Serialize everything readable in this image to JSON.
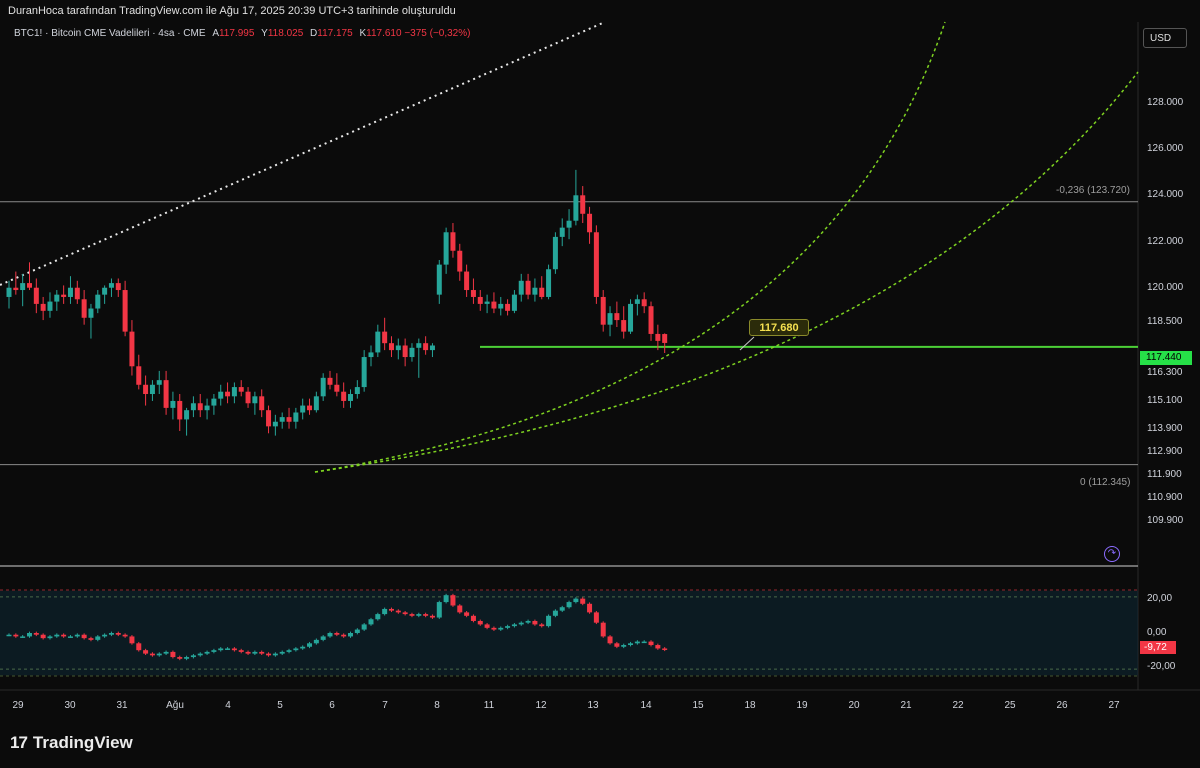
{
  "header": {
    "caption": "DuranHoca tarafından TradingView.com ile Ağu 17, 2025 20:39 UTC+3 tarihinde oluşturuldu"
  },
  "symbol": {
    "title": "BTC1! · Bitcoin CME Vadelileri · 4sa · CME",
    "open_label": "A",
    "open_value": "117.995",
    "high_label": "Y",
    "high_value": "118.025",
    "low_label": "D",
    "low_value": "117.175",
    "close_label": "K",
    "close_value": "117.610",
    "change": "−375 (−0,32%)"
  },
  "currency_button": "USD",
  "price_axis": [
    "128.000",
    "126.000",
    "124.000",
    "122.000",
    "120.000",
    "118.500",
    "116.300",
    "115.100",
    "113.900",
    "112.900",
    "111.900",
    "110.900",
    "109.900"
  ],
  "price_axis_values": [
    128000,
    126000,
    124000,
    122000,
    120000,
    118500,
    116300,
    115100,
    113900,
    112900,
    111900,
    110900,
    109900
  ],
  "current_price": "117.440",
  "callout_price": "117.680",
  "fib_labels": {
    "upper": "-0,236 (123.720)",
    "lower": "0 (112.345)"
  },
  "oscillator": {
    "axis": [
      "20,00",
      "0,00",
      "-20,00"
    ],
    "axis_values": [
      20,
      0,
      -20
    ],
    "current": "-9,72"
  },
  "time_axis": [
    "29",
    "30",
    "31",
    "Ağu",
    "4",
    "5",
    "6",
    "7",
    "8",
    "11",
    "12",
    "13",
    "14",
    "15",
    "18",
    "19",
    "20",
    "21",
    "22",
    "25",
    "26",
    "27"
  ],
  "brand": {
    "mark": "17",
    "name": "TradingView"
  },
  "colors": {
    "up": "#26a69a",
    "down": "#f23645",
    "price_line": "#4cd137",
    "curve": "#7ed321",
    "background": "#0b0b0b"
  },
  "chart_data": {
    "type": "candlestick",
    "interval": "4h",
    "candles": [
      {
        "o": 119600,
        "h": 120300,
        "l": 119100,
        "c": 120000
      },
      {
        "o": 120000,
        "h": 120700,
        "l": 119700,
        "c": 119900
      },
      {
        "o": 119900,
        "h": 120600,
        "l": 119200,
        "c": 120200
      },
      {
        "o": 120200,
        "h": 121100,
        "l": 119900,
        "c": 120000
      },
      {
        "o": 120000,
        "h": 120400,
        "l": 118900,
        "c": 119300
      },
      {
        "o": 119300,
        "h": 119600,
        "l": 118600,
        "c": 119000
      },
      {
        "o": 119000,
        "h": 119800,
        "l": 118700,
        "c": 119400
      },
      {
        "o": 119400,
        "h": 119900,
        "l": 119000,
        "c": 119700
      },
      {
        "o": 119700,
        "h": 120100,
        "l": 119300,
        "c": 119600
      },
      {
        "o": 119600,
        "h": 120500,
        "l": 119300,
        "c": 120000
      },
      {
        "o": 120000,
        "h": 120300,
        "l": 119300,
        "c": 119500
      },
      {
        "o": 119500,
        "h": 119900,
        "l": 118400,
        "c": 118700
      },
      {
        "o": 118700,
        "h": 119300,
        "l": 117800,
        "c": 119100
      },
      {
        "o": 119100,
        "h": 119900,
        "l": 118900,
        "c": 119700
      },
      {
        "o": 119700,
        "h": 120100,
        "l": 119300,
        "c": 120000
      },
      {
        "o": 120000,
        "h": 120400,
        "l": 119600,
        "c": 120200
      },
      {
        "o": 120200,
        "h": 120400,
        "l": 119600,
        "c": 119900
      },
      {
        "o": 119900,
        "h": 120300,
        "l": 117900,
        "c": 118100
      },
      {
        "o": 118100,
        "h": 118600,
        "l": 116200,
        "c": 116600
      },
      {
        "o": 116600,
        "h": 117100,
        "l": 115600,
        "c": 115800
      },
      {
        "o": 115800,
        "h": 116200,
        "l": 114900,
        "c": 115400
      },
      {
        "o": 115400,
        "h": 116000,
        "l": 115100,
        "c": 115800
      },
      {
        "o": 115800,
        "h": 116400,
        "l": 115400,
        "c": 116000
      },
      {
        "o": 116000,
        "h": 116400,
        "l": 114500,
        "c": 114800
      },
      {
        "o": 114800,
        "h": 115500,
        "l": 114300,
        "c": 115100
      },
      {
        "o": 115100,
        "h": 115400,
        "l": 113800,
        "c": 114300
      },
      {
        "o": 114300,
        "h": 114800,
        "l": 113600,
        "c": 114700
      },
      {
        "o": 114700,
        "h": 115300,
        "l": 114400,
        "c": 115000
      },
      {
        "o": 115000,
        "h": 115400,
        "l": 114400,
        "c": 114700
      },
      {
        "o": 114700,
        "h": 115200,
        "l": 114300,
        "c": 114900
      },
      {
        "o": 114900,
        "h": 115400,
        "l": 114500,
        "c": 115200
      },
      {
        "o": 115200,
        "h": 115800,
        "l": 114900,
        "c": 115500
      },
      {
        "o": 115500,
        "h": 115900,
        "l": 115000,
        "c": 115300
      },
      {
        "o": 115300,
        "h": 115900,
        "l": 115000,
        "c": 115700
      },
      {
        "o": 115700,
        "h": 116000,
        "l": 115300,
        "c": 115500
      },
      {
        "o": 115500,
        "h": 115700,
        "l": 114800,
        "c": 115000
      },
      {
        "o": 115000,
        "h": 115500,
        "l": 114500,
        "c": 115300
      },
      {
        "o": 115300,
        "h": 115600,
        "l": 114400,
        "c": 114700
      },
      {
        "o": 114700,
        "h": 114900,
        "l": 113700,
        "c": 114000
      },
      {
        "o": 114000,
        "h": 114500,
        "l": 113600,
        "c": 114200
      },
      {
        "o": 114200,
        "h": 114600,
        "l": 113900,
        "c": 114400
      },
      {
        "o": 114400,
        "h": 114800,
        "l": 113900,
        "c": 114200
      },
      {
        "o": 114200,
        "h": 114800,
        "l": 113900,
        "c": 114600
      },
      {
        "o": 114600,
        "h": 115200,
        "l": 114300,
        "c": 114900
      },
      {
        "o": 114900,
        "h": 115200,
        "l": 114500,
        "c": 114700
      },
      {
        "o": 114700,
        "h": 115500,
        "l": 114600,
        "c": 115300
      },
      {
        "o": 115300,
        "h": 116300,
        "l": 115100,
        "c": 116100
      },
      {
        "o": 116100,
        "h": 116400,
        "l": 115600,
        "c": 115800
      },
      {
        "o": 115800,
        "h": 116300,
        "l": 115300,
        "c": 115500
      },
      {
        "o": 115500,
        "h": 115900,
        "l": 114800,
        "c": 115100
      },
      {
        "o": 115100,
        "h": 115600,
        "l": 114800,
        "c": 115400
      },
      {
        "o": 115400,
        "h": 116000,
        "l": 115200,
        "c": 115700
      },
      {
        "o": 115700,
        "h": 117300,
        "l": 115500,
        "c": 117000
      },
      {
        "o": 117000,
        "h": 117500,
        "l": 116600,
        "c": 117200
      },
      {
        "o": 117200,
        "h": 118400,
        "l": 117000,
        "c": 118100
      },
      {
        "o": 118100,
        "h": 118700,
        "l": 117300,
        "c": 117600
      },
      {
        "o": 117600,
        "h": 117900,
        "l": 117000,
        "c": 117300
      },
      {
        "o": 117300,
        "h": 117800,
        "l": 116900,
        "c": 117500
      },
      {
        "o": 117500,
        "h": 117800,
        "l": 116600,
        "c": 117000
      },
      {
        "o": 117000,
        "h": 117600,
        "l": 116800,
        "c": 117400
      },
      {
        "o": 117400,
        "h": 117800,
        "l": 116100,
        "c": 117600
      },
      {
        "o": 117600,
        "h": 117900,
        "l": 117100,
        "c": 117300
      },
      {
        "o": 117300,
        "h": 117600,
        "l": 117000,
        "c": 117500
      },
      {
        "o": 119700,
        "h": 121200,
        "l": 119300,
        "c": 121000
      },
      {
        "o": 121000,
        "h": 122600,
        "l": 120600,
        "c": 122400
      },
      {
        "o": 122400,
        "h": 122800,
        "l": 121300,
        "c": 121600
      },
      {
        "o": 121600,
        "h": 121900,
        "l": 120300,
        "c": 120700
      },
      {
        "o": 120700,
        "h": 121000,
        "l": 119600,
        "c": 119900
      },
      {
        "o": 119900,
        "h": 120400,
        "l": 119300,
        "c": 119600
      },
      {
        "o": 119600,
        "h": 119900,
        "l": 119000,
        "c": 119300
      },
      {
        "o": 119300,
        "h": 119700,
        "l": 118900,
        "c": 119400
      },
      {
        "o": 119400,
        "h": 119800,
        "l": 118900,
        "c": 119100
      },
      {
        "o": 119100,
        "h": 119600,
        "l": 118800,
        "c": 119300
      },
      {
        "o": 119300,
        "h": 119500,
        "l": 118800,
        "c": 119000
      },
      {
        "o": 119000,
        "h": 119900,
        "l": 118900,
        "c": 119700
      },
      {
        "o": 119700,
        "h": 120600,
        "l": 119400,
        "c": 120300
      },
      {
        "o": 120300,
        "h": 120600,
        "l": 119500,
        "c": 119700
      },
      {
        "o": 119700,
        "h": 120400,
        "l": 119400,
        "c": 120000
      },
      {
        "o": 120000,
        "h": 120500,
        "l": 119500,
        "c": 119600
      },
      {
        "o": 119600,
        "h": 121000,
        "l": 119500,
        "c": 120800
      },
      {
        "o": 120800,
        "h": 122400,
        "l": 120600,
        "c": 122200
      },
      {
        "o": 122200,
        "h": 123000,
        "l": 121800,
        "c": 122600
      },
      {
        "o": 122600,
        "h": 123400,
        "l": 122100,
        "c": 122900
      },
      {
        "o": 122900,
        "h": 125100,
        "l": 122700,
        "c": 124000
      },
      {
        "o": 124000,
        "h": 124400,
        "l": 122800,
        "c": 123200
      },
      {
        "o": 123200,
        "h": 123500,
        "l": 121900,
        "c": 122400
      },
      {
        "o": 122400,
        "h": 122700,
        "l": 119300,
        "c": 119600
      },
      {
        "o": 119600,
        "h": 119900,
        "l": 118100,
        "c": 118400
      },
      {
        "o": 118400,
        "h": 119200,
        "l": 117900,
        "c": 118900
      },
      {
        "o": 118900,
        "h": 119400,
        "l": 118300,
        "c": 118600
      },
      {
        "o": 118600,
        "h": 119200,
        "l": 117800,
        "c": 118100
      },
      {
        "o": 118100,
        "h": 119500,
        "l": 118000,
        "c": 119300
      },
      {
        "o": 119300,
        "h": 119700,
        "l": 118800,
        "c": 119500
      },
      {
        "o": 119500,
        "h": 119800,
        "l": 118900,
        "c": 119200
      },
      {
        "o": 119200,
        "h": 119400,
        "l": 117700,
        "c": 118000
      },
      {
        "o": 118000,
        "h": 118400,
        "l": 117300,
        "c": 117700
      },
      {
        "o": 117995,
        "h": 118025,
        "l": 117175,
        "c": 117610
      }
    ],
    "oscillator_values": [
      -1,
      -2,
      -2,
      0,
      -1,
      -3,
      -2,
      -1,
      -2,
      -2,
      -1,
      -3,
      -4,
      -2,
      -1,
      0,
      -1,
      -2,
      -6,
      -10,
      -12,
      -13,
      -12,
      -11,
      -14,
      -15,
      -14,
      -13,
      -12,
      -11,
      -10,
      -9,
      -9,
      -10,
      -11,
      -12,
      -11,
      -12,
      -13,
      -12,
      -11,
      -10,
      -9,
      -8,
      -6,
      -4,
      -2,
      0,
      -1,
      -2,
      0,
      2,
      5,
      8,
      11,
      14,
      13,
      12,
      11,
      10,
      11,
      10,
      9,
      18,
      22,
      16,
      12,
      10,
      7,
      5,
      3,
      2,
      3,
      4,
      5,
      6,
      7,
      5,
      4,
      10,
      13,
      15,
      18,
      20,
      17,
      12,
      6,
      -2,
      -6,
      -8,
      -7,
      -6,
      -5,
      -5,
      -7,
      -9,
      -9.72
    ],
    "fib_levels": [
      {
        "label": "-0,236",
        "value": 123720
      },
      {
        "label": "0",
        "value": 112345
      }
    ],
    "price_line": 117440,
    "ylim": [
      108000,
      131500
    ]
  }
}
